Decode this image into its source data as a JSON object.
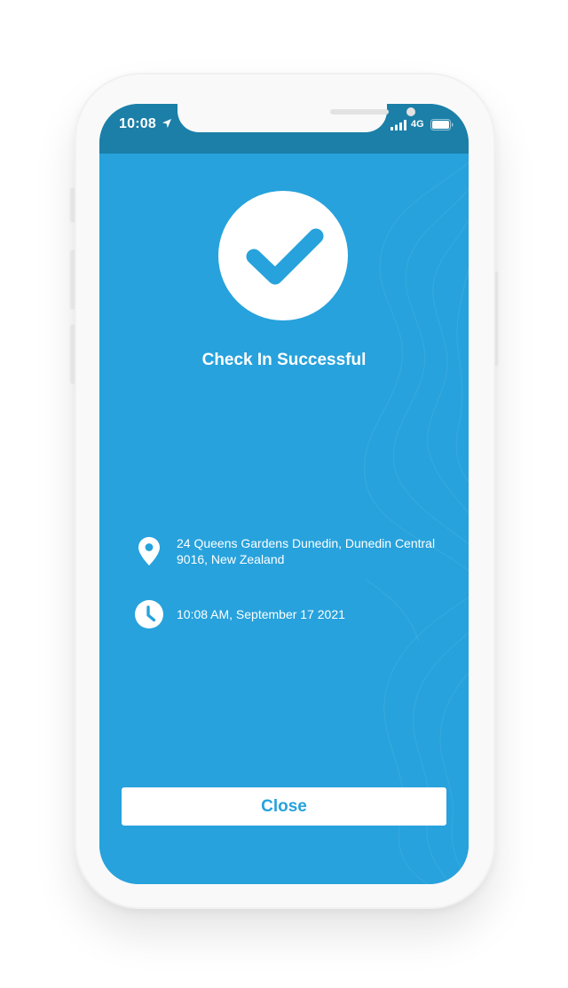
{
  "status_bar": {
    "time": "10:08",
    "network": "4G"
  },
  "checkin": {
    "title": "Check In Successful",
    "address": "24 Queens Gardens Dunedin, Dunedin Central 9016, New Zealand",
    "datetime": "10:08 AM, September 17 2021"
  },
  "actions": {
    "close_label": "Close"
  },
  "icons": {
    "success": "checkmark-icon",
    "location": "map-pin-icon",
    "time": "clock-icon"
  },
  "colors": {
    "primary": "#27a2dc",
    "status_bar": "#1b7fa8",
    "text_on_primary": "#ffffff"
  }
}
